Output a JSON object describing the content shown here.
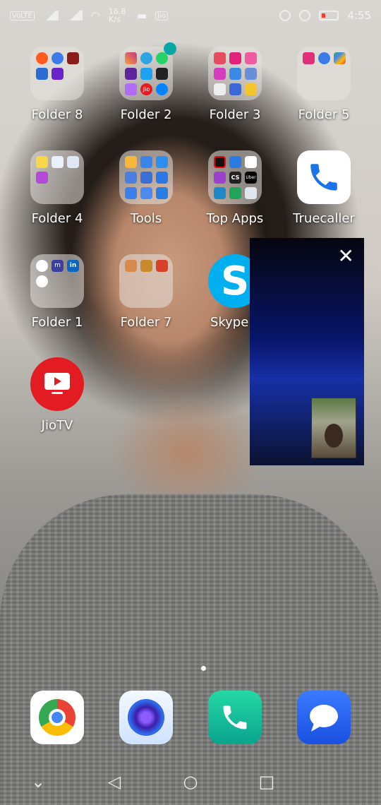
{
  "status_bar": {
    "carrier": "VoLTE",
    "net_speed": "16.8 K/s",
    "time": "4:55"
  },
  "apps": [
    {
      "label": "Folder 8",
      "type": "folder"
    },
    {
      "label": "Folder 2",
      "type": "folder"
    },
    {
      "label": "Folder 3",
      "type": "folder"
    },
    {
      "label": "Folder 5",
      "type": "folder"
    },
    {
      "label": "Folder 4",
      "type": "folder"
    },
    {
      "label": "Tools",
      "type": "folder"
    },
    {
      "label": "Top Apps",
      "type": "folder"
    },
    {
      "label": "Truecaller",
      "type": "app",
      "icon": "truecaller-phone-icon"
    },
    {
      "label": "Folder 1",
      "type": "folder"
    },
    {
      "label": "Folder 7",
      "type": "folder"
    },
    {
      "label": "Skype L",
      "type": "app",
      "icon": "skype-icon"
    },
    {
      "label": "JioTV",
      "type": "app",
      "icon": "jiotv-icon"
    }
  ],
  "folder_mini_texts": {
    "folder2_jio": "Jio",
    "topapps_cs": "CS",
    "topapps_uber": "Uber",
    "folder1_m": "m",
    "folder1_in": "in"
  },
  "pip": {
    "close_symbol": "✕"
  },
  "dock": [
    {
      "icon": "chrome-icon"
    },
    {
      "icon": "camera-icon"
    },
    {
      "icon": "phone-icon"
    },
    {
      "icon": "messages-icon"
    }
  ],
  "navbar": {
    "back": "◁",
    "home": "○",
    "recents": "□",
    "collapse": "⌄"
  },
  "colors": {
    "truecaller_blue": "#1a73e8",
    "jiotv_red": "#e31b23",
    "skype_blue": "#00aff0",
    "phone_green": "#10c4a0",
    "messages_blue": "#1a5cf0"
  }
}
